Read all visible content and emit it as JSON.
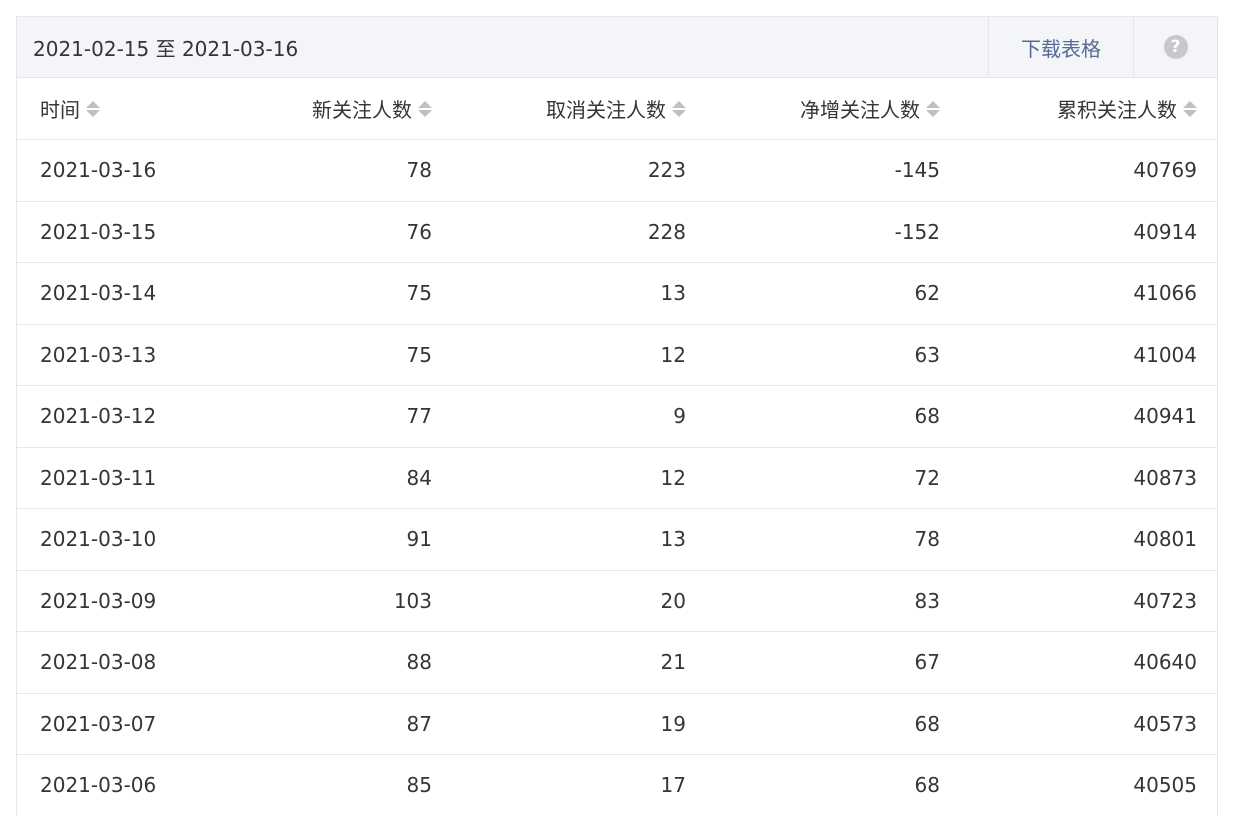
{
  "toolbar": {
    "date_range": "2021-02-15 至 2021-03-16",
    "download_label": "下载表格",
    "help_label": "?"
  },
  "table": {
    "columns": [
      "时间",
      "新关注人数",
      "取消关注人数",
      "净增关注人数",
      "累积关注人数"
    ],
    "rows": [
      [
        "2021-03-16",
        "78",
        "223",
        "-145",
        "40769"
      ],
      [
        "2021-03-15",
        "76",
        "228",
        "-152",
        "40914"
      ],
      [
        "2021-03-14",
        "75",
        "13",
        "62",
        "41066"
      ],
      [
        "2021-03-13",
        "75",
        "12",
        "63",
        "41004"
      ],
      [
        "2021-03-12",
        "77",
        "9",
        "68",
        "40941"
      ],
      [
        "2021-03-11",
        "84",
        "12",
        "72",
        "40873"
      ],
      [
        "2021-03-10",
        "91",
        "13",
        "78",
        "40801"
      ],
      [
        "2021-03-09",
        "103",
        "20",
        "83",
        "40723"
      ],
      [
        "2021-03-08",
        "88",
        "21",
        "67",
        "40640"
      ],
      [
        "2021-03-07",
        "87",
        "19",
        "68",
        "40573"
      ],
      [
        "2021-03-06",
        "85",
        "17",
        "68",
        "40505"
      ]
    ]
  },
  "colors": {
    "link": "#576b95",
    "toolbar_bg": "#f4f5f9",
    "border": "#e7e7eb",
    "sort_icon": "#c0c0c4"
  }
}
